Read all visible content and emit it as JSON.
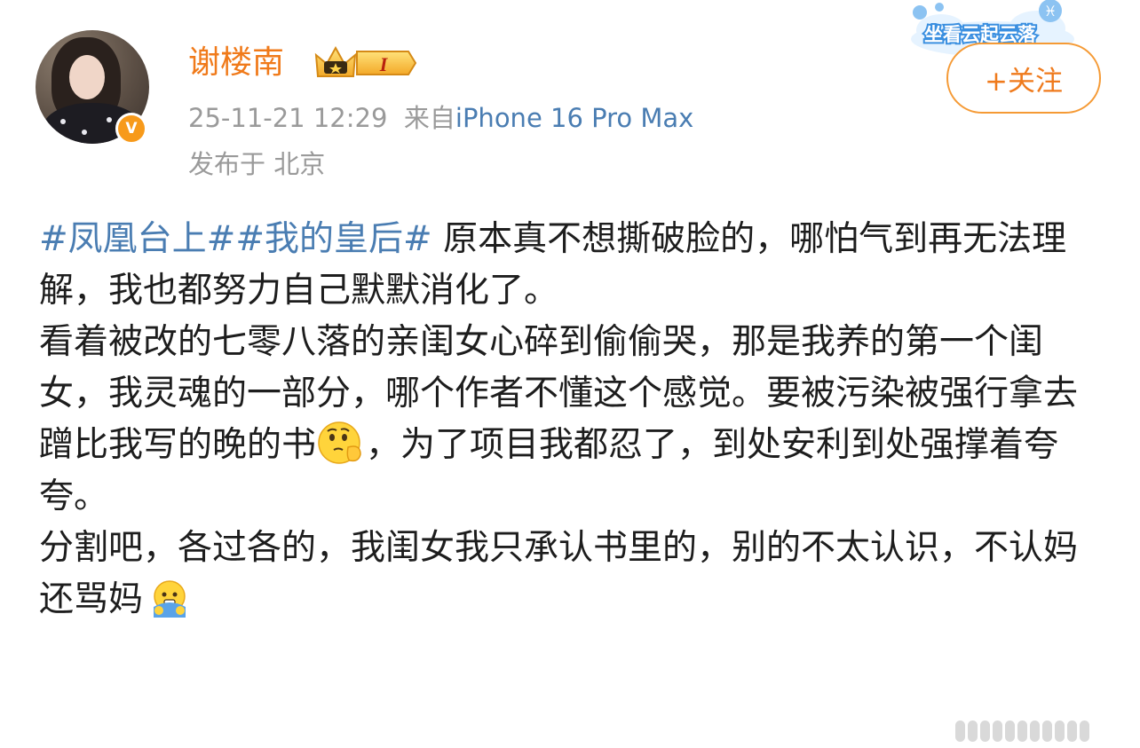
{
  "user": {
    "name": "谢楼南",
    "verified_badge": "V",
    "level_badge": "I"
  },
  "post_meta": {
    "time": "25-11-21 12:29",
    "from_label": "来自",
    "device": "iPhone 16 Pro Max",
    "location": "发布于 北京"
  },
  "decoration": {
    "text": "坐看云起云落"
  },
  "follow_button": {
    "label": "+关注"
  },
  "content": {
    "topic1": "#凤凰台上#",
    "topic2": "#我的皇后#",
    "seg1": " 原本真不想撕破脸的，哪怕气到再无法理解，我也都努力自己默默消化了。",
    "seg2": "看着被改的七零八落的亲闺女心碎到偷偷哭，那是我养的第一个闺女，我灵魂的一部分，哪个作者不懂这个感觉。要被污染被强行拿去蹭比我写的晚的书",
    "seg3": "，为了项目我都忍了，到处安利到处强撑着夸夸。",
    "seg4": "分割吧，各过各的，我闺女我只承认书里的，别的不太认识，不认妈还骂妈",
    "emoji1": "thinking-emoji",
    "emoji2": "shivering-emoji"
  },
  "colors": {
    "username": "#f07a1a",
    "link": "#4a7db2",
    "meta": "#9a9a9a",
    "follow": "#ef7a1c",
    "badge": "#f79a1b"
  }
}
